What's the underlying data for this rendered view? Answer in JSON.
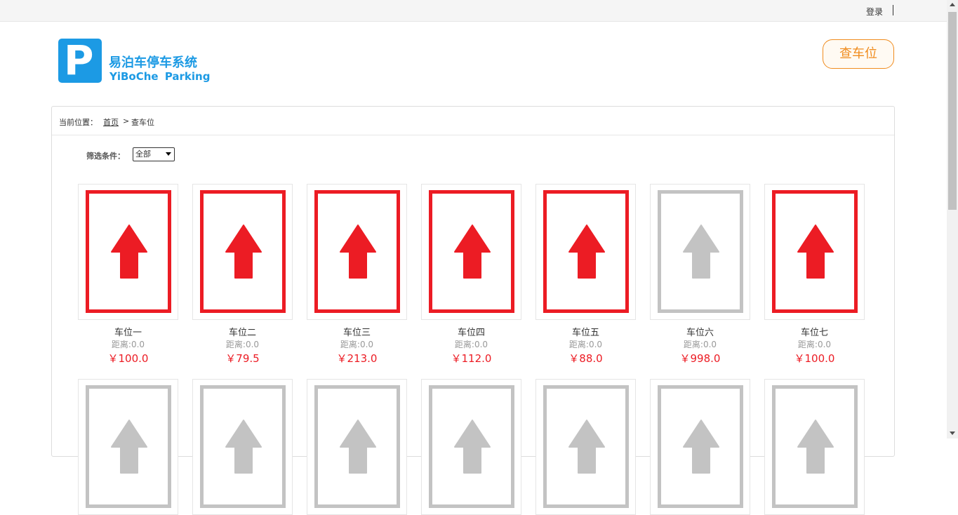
{
  "topbar": {
    "login": "登录"
  },
  "brand": {
    "logo_letter": "P",
    "name_cn": "易泊车停车系统",
    "name_en": "YiBoChe Parking",
    "color": "#1c9ae4"
  },
  "header": {
    "find_button": "查车位"
  },
  "breadcrumb": {
    "label": "当前位置：",
    "home": "首页",
    "separator": ">",
    "current": "查车位"
  },
  "filter": {
    "label": "筛选条件：",
    "selected": "全部"
  },
  "colors": {
    "available": "#ec1c24",
    "unavailable": "#c3c3c3",
    "accent": "#f08c1e"
  },
  "spots": [
    {
      "name": "车位一",
      "distance": "距离:0.0",
      "price": "￥100.0",
      "status": "available"
    },
    {
      "name": "车位二",
      "distance": "距离:0.0",
      "price": "￥79.5",
      "status": "available"
    },
    {
      "name": "车位三",
      "distance": "距离:0.0",
      "price": "￥213.0",
      "status": "available"
    },
    {
      "name": "车位四",
      "distance": "距离:0.0",
      "price": "￥112.0",
      "status": "available"
    },
    {
      "name": "车位五",
      "distance": "距离:0.0",
      "price": "￥88.0",
      "status": "available"
    },
    {
      "name": "车位六",
      "distance": "距离:0.0",
      "price": "￥998.0",
      "status": "unavailable"
    },
    {
      "name": "车位七",
      "distance": "距离:0.0",
      "price": "￥100.0",
      "status": "available"
    }
  ],
  "row2_spots": [
    {
      "status": "unavailable"
    },
    {
      "status": "unavailable"
    },
    {
      "status": "unavailable"
    },
    {
      "status": "unavailable"
    },
    {
      "status": "unavailable"
    },
    {
      "status": "unavailable"
    },
    {
      "status": "unavailable"
    }
  ]
}
